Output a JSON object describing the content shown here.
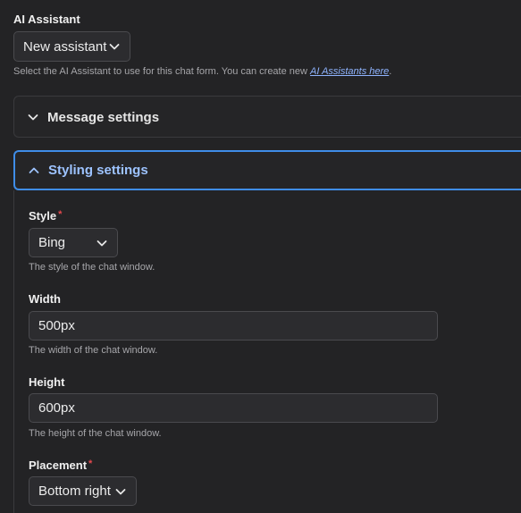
{
  "assistant": {
    "label": "AI Assistant",
    "selected": "New assistant",
    "help_prefix": "Select the AI Assistant to use for this chat form. You can create new ",
    "help_link": "AI Assistants here",
    "help_suffix": "."
  },
  "message_settings": {
    "title": "Message settings",
    "expanded": false
  },
  "styling_settings": {
    "title": "Styling settings",
    "expanded": true,
    "style": {
      "label": "Style",
      "required_mark": "*",
      "selected": "Bing",
      "help": "The style of the chat window."
    },
    "width": {
      "label": "Width",
      "value": "500px",
      "help": "The width of the chat window."
    },
    "height": {
      "label": "Height",
      "value": "600px",
      "help": "The height of the chat window."
    },
    "placement": {
      "label": "Placement",
      "required_mark": "*",
      "selected": "Bottom right"
    }
  },
  "colors": {
    "background": "#232325",
    "accent": "#3f8de8",
    "accent_text": "#9dc3ff",
    "required": "#e5484d",
    "link": "#8fb4ff"
  },
  "icons": {
    "dropdown": "chevron-down-icon",
    "collapsed_section": "chevron-down-icon",
    "expanded_section": "chevron-up-icon"
  }
}
